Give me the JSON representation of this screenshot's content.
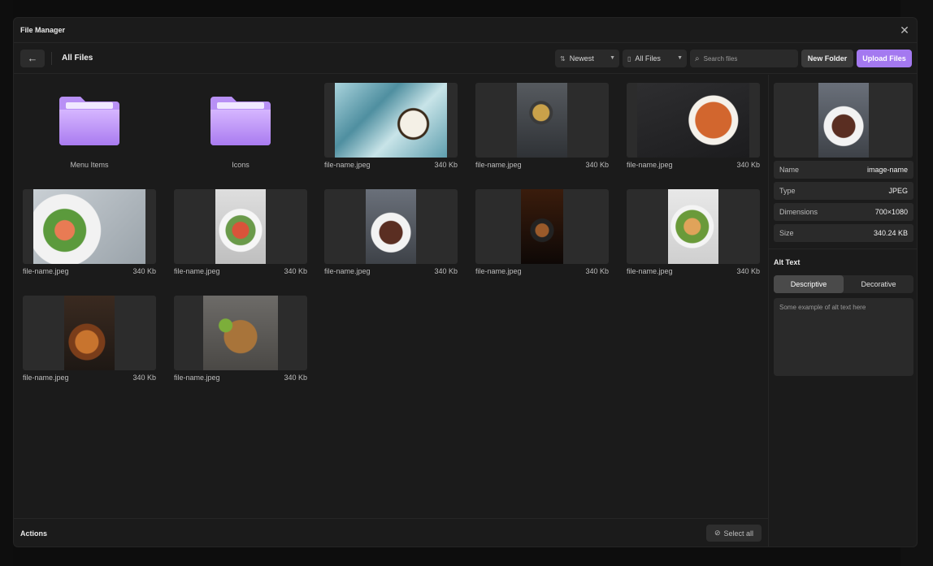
{
  "modal": {
    "title": "File Manager"
  },
  "toolbar": {
    "back_icon": "arrow-left-icon",
    "title": "All Files",
    "sort": {
      "value": "Newest",
      "icon": "sort-icon"
    },
    "filter": {
      "value": "All Files",
      "icon": "file-icon"
    },
    "search": {
      "placeholder": "Search files",
      "icon": "search-icon"
    },
    "new_folder_label": "New Folder",
    "upload_label": "Upload Files",
    "accent_color": "#a479f0"
  },
  "folders": [
    {
      "label": "Menu Items"
    },
    {
      "label": "Icons"
    }
  ],
  "files": [
    {
      "name": "file-name.jpeg",
      "size": "340 Kb"
    },
    {
      "name": "file-name.jpeg",
      "size": "340 Kb"
    },
    {
      "name": "file-name.jpeg",
      "size": "340 Kb"
    },
    {
      "name": "file-name.jpeg",
      "size": "340 Kb"
    },
    {
      "name": "file-name.jpeg",
      "size": "340 Kb"
    },
    {
      "name": "file-name.jpeg",
      "size": "340 Kb"
    },
    {
      "name": "file-name.jpeg",
      "size": "340 Kb"
    },
    {
      "name": "file-name.jpeg",
      "size": "340 Kb"
    },
    {
      "name": "file-name.jpeg",
      "size": "340 Kb"
    },
    {
      "name": "file-name.jpeg",
      "size": "340 Kb"
    }
  ],
  "footer": {
    "title": "Actions",
    "select_all_label": "Select all"
  },
  "details": {
    "rows": [
      {
        "key": "Name",
        "value": "image-name"
      },
      {
        "key": "Type",
        "value": "JPEG"
      },
      {
        "key": "Dimensions",
        "value": "700×1080"
      },
      {
        "key": "Size",
        "value": "340.24 KB"
      }
    ],
    "alt_text_title": "Alt Text",
    "alt_modes": [
      "Descriptive",
      "Decorative"
    ],
    "alt_mode_selected": "Descriptive",
    "alt_placeholder": "Some example of alt text here"
  }
}
